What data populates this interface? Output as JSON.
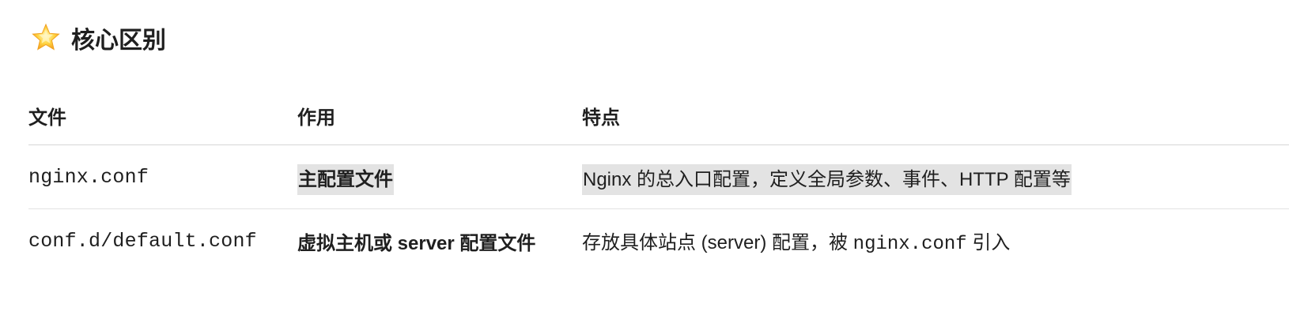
{
  "heading": {
    "icon": "star-icon",
    "title": "核心区别"
  },
  "table": {
    "headers": [
      "文件",
      "作用",
      "特点"
    ],
    "rows": [
      {
        "file": "nginx.conf",
        "role": "主配置文件",
        "feature": "Nginx 的总入口配置，定义全局参数、事件、HTTP 配置等"
      },
      {
        "file": "conf.d/default.conf",
        "role": "虚拟主机或 server 配置文件",
        "feature_pre": "存放具体站点 (server) 配置，被 ",
        "feature_code": "nginx.conf",
        "feature_post": " 引入"
      }
    ]
  },
  "colors": {
    "highlight": "#e3e3e3",
    "divider": "#e3e3e3",
    "text": "#1f1f1f"
  }
}
